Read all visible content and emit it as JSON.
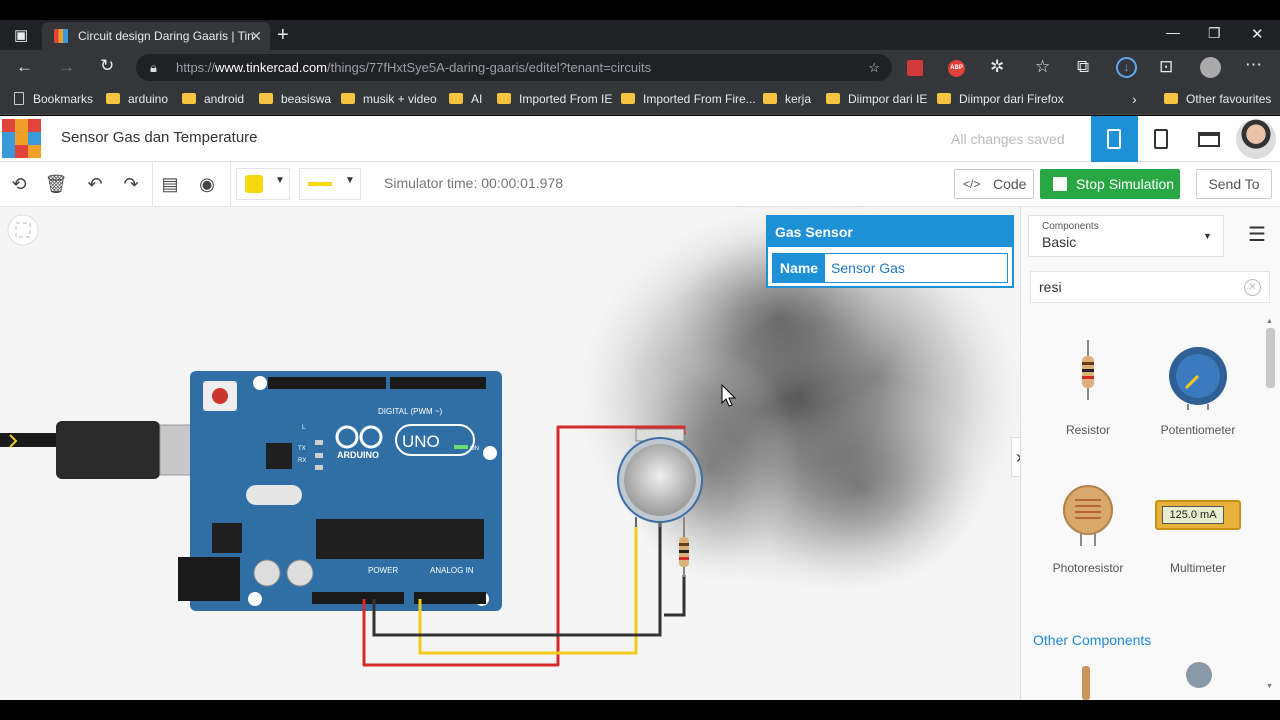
{
  "browser": {
    "tab_title": "Circuit design Daring Gaaris | Tin",
    "url_prefix": "https://",
    "url_host": "www.tinkercad.com",
    "url_path": "/things/77fHxtSye5A-daring-gaaris/editel?tenant=circuits",
    "bookmarks": [
      "Bookmarks",
      "arduino",
      "android",
      "beasiswa",
      "musik + video",
      "AI",
      "Imported From IE",
      "Imported From Fire...",
      "kerja",
      "Diimpor dari IE",
      "Diimpor dari Firefox"
    ],
    "other_favourites": "Other favourites",
    "ext_abp": "ABP"
  },
  "app": {
    "logo_letters": [
      "TIN",
      "KER",
      "CAD"
    ],
    "project_title": "Sensor Gas dan Temperature",
    "save_status": "All changes saved"
  },
  "toolbar": {
    "sim_time": "Simulator time: 00:00:01.978",
    "code_label": "Code",
    "stop_label": "Stop Simulation",
    "send_label": "Send To",
    "fill_color": "#f5d90a",
    "wire_color": "#f5d90a"
  },
  "inspector": {
    "title": "Gas Sensor",
    "name_label": "Name",
    "name_value": "Sensor Gas"
  },
  "panel": {
    "components_caption": "Components",
    "components_value": "Basic",
    "search_value": "resi",
    "items": [
      "Resistor",
      "Potentiometer",
      "Photoresistor",
      "Multimeter"
    ],
    "multimeter_reading": "125.0 mA",
    "other_components": "Other Components"
  },
  "board": {
    "brand": "ARDUINO",
    "model": "UNO",
    "digital_label": "DIGITAL (PWM ~)",
    "power_label": "POWER",
    "analog_label": "ANALOG IN",
    "on_label": "ON",
    "tx": "TX",
    "rx": "RX",
    "l": "L"
  },
  "colors": {
    "accent": "#1e90d6",
    "stop_green": "#29a745",
    "board_blue": "#2f6fa6",
    "wire_red": "#d62b2b",
    "wire_yellow": "#f2cc1d",
    "wire_black": "#333333"
  }
}
